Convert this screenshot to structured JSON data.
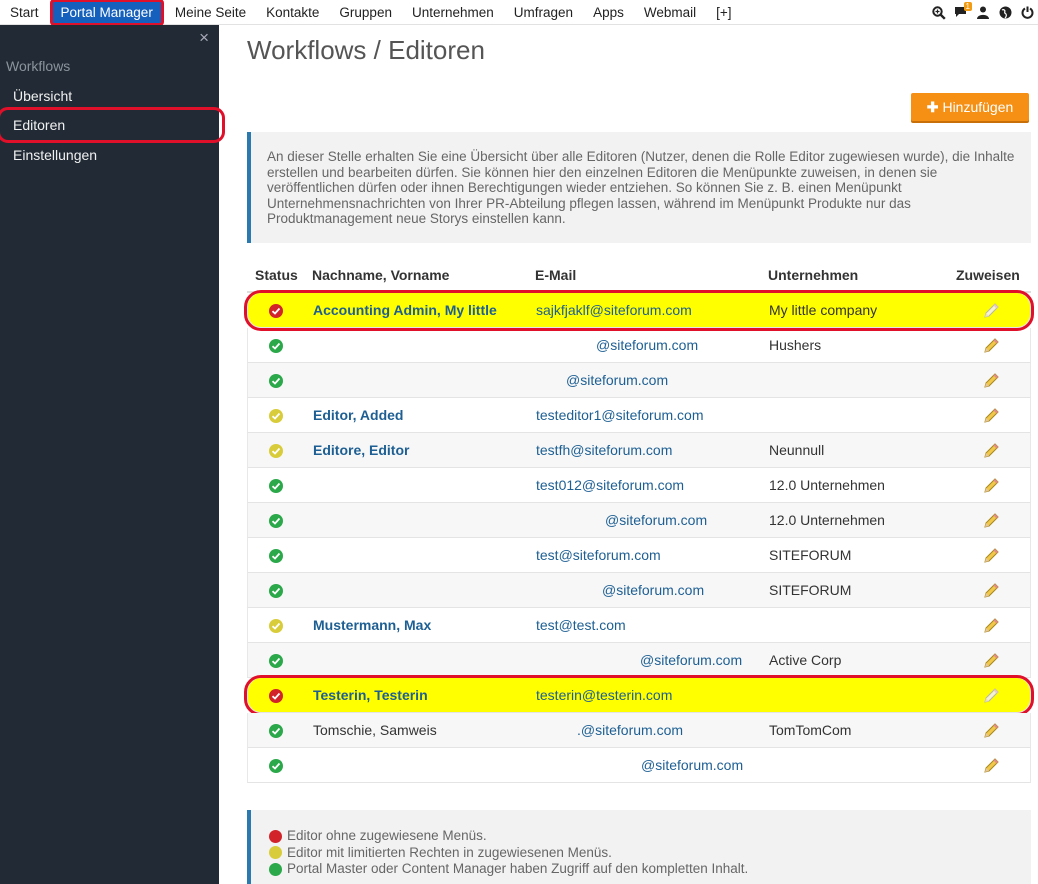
{
  "topnav": {
    "items": [
      "Start",
      "Portal Manager",
      "Meine Seite",
      "Kontakte",
      "Gruppen",
      "Unternehmen",
      "Umfragen",
      "Apps",
      "Webmail",
      "[+]"
    ],
    "active_index": 1,
    "icons": [
      "search-icon",
      "chat-icon",
      "user-icon",
      "globe-icon",
      "power-icon"
    ],
    "chat_badge": "1"
  },
  "sidebar": {
    "close": "×",
    "section": "Workflows",
    "items": [
      "Übersicht",
      "Editoren",
      "Einstellungen"
    ],
    "selected_index": 1
  },
  "main": {
    "title": "Workflows / Editoren",
    "add_button": "Hinzufügen",
    "info_text": "An dieser Stelle erhalten Sie eine Übersicht über alle Editoren (Nutzer, denen die Rolle Editor zugewiesen wurde), die Inhalte erstellen und bearbeiten dürfen. Sie können hier den einzelnen Editoren die Menüpunkte zuweisen, in denen sie veröffentlichen dürfen oder ihnen Berechtigungen wieder entziehen. So können Sie z. B. einen Menüpunkt Unternehmensnachrichten von Ihrer PR-Abteilung pflegen lassen, während im Menüpunkt Produkte nur das Produktmanagement neue Storys einstellen kann."
  },
  "table": {
    "headers": {
      "status": "Status",
      "name": "Nachname, Vorname",
      "email": "E-Mail",
      "company": "Unternehmen",
      "assign": "Zuweisen"
    },
    "rows": [
      {
        "status": "red",
        "name": "Accounting Admin, My little",
        "email": "sajkfjaklf@siteforum.com",
        "company": "My little company",
        "highlight": true
      },
      {
        "status": "green",
        "name": "",
        "email": "@siteforum.com",
        "company": "Hushers",
        "highlight": false
      },
      {
        "status": "green",
        "name": "",
        "email": "@siteforum.com",
        "company": "",
        "highlight": false
      },
      {
        "status": "yellow",
        "name": "Editor, Added",
        "email": "testeditor1@siteforum.com",
        "company": "",
        "highlight": false
      },
      {
        "status": "yellow",
        "name": "Editore, Editor",
        "email": "testfh@siteforum.com",
        "company": "Neunnull",
        "highlight": false
      },
      {
        "status": "green",
        "name": "",
        "email": "test012@siteforum.com",
        "company": "12.0 Unternehmen",
        "highlight": false
      },
      {
        "status": "green",
        "name": "",
        "email": "@siteforum.com",
        "company": "12.0 Unternehmen",
        "highlight": false
      },
      {
        "status": "green",
        "name": "",
        "email": "test@siteforum.com",
        "company": "SITEFORUM",
        "highlight": false
      },
      {
        "status": "green",
        "name": "",
        "email": "@siteforum.com",
        "company": "SITEFORUM",
        "highlight": false
      },
      {
        "status": "yellow",
        "name": "Mustermann, Max",
        "email": "test@test.com",
        "company": "",
        "highlight": false
      },
      {
        "status": "green",
        "name": "",
        "email": "@siteforum.com",
        "company": "Active Corp",
        "highlight": false
      },
      {
        "status": "red",
        "name": "Testerin, Testerin",
        "email": "testerin@testerin.com",
        "company": "",
        "highlight": true
      },
      {
        "status": "green",
        "name": "Tomschie, Samweis",
        "email": ".@siteforum.com",
        "company": "TomTomCom",
        "highlight": false
      },
      {
        "status": "green",
        "name": "",
        "email": "@siteforum.com",
        "company": "",
        "highlight": false
      }
    ]
  },
  "legend": {
    "items": [
      {
        "status": "red",
        "text": "Editor ohne zugewiesene Menüs."
      },
      {
        "status": "yellow",
        "text": "Editor mit limitierten Rechten in zugewiesenen Menüs."
      },
      {
        "status": "green",
        "text": "Portal Master oder Content Manager haben Zugriff auf den kompletten Inhalt."
      }
    ]
  },
  "colors": {
    "accent": "#1560bd",
    "sidebar_bg": "#222b35",
    "button_orange": "#f59015",
    "highlight_yellow": "#ffff00",
    "annotation_red": "#e0102a",
    "status_green": "#2ba84a",
    "status_yellow": "#d9cc3a",
    "status_red": "#d2232a"
  }
}
